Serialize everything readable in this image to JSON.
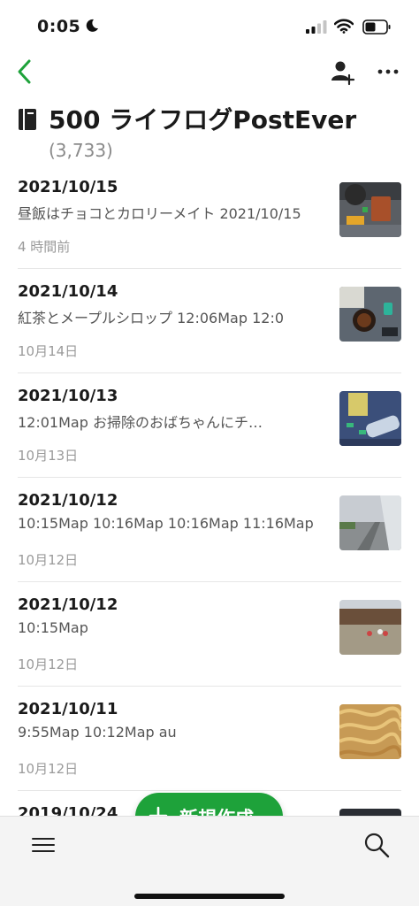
{
  "status_bar": {
    "time": "0:05"
  },
  "notebook": {
    "title": "500 ライフログPostEver",
    "count": "(3,733)"
  },
  "notes": [
    {
      "title": "2021/10/15",
      "snippet": "昼飯はチョコとカロリーメイト 2021/10/15",
      "date": "4 時間前",
      "thumb": "thumb-food-desk"
    },
    {
      "title": "2021/10/14",
      "snippet": "紅茶とメープルシロップ 12:06Map 12:0",
      "date": "10月14日",
      "thumb": "thumb-tea-desk"
    },
    {
      "title": "2021/10/13",
      "snippet": "12:01Map お掃除のおばちゃんにチ…",
      "date": "10月13日",
      "thumb": "thumb-bottle-desk"
    },
    {
      "title": "2021/10/12",
      "snippet": "10:15Map 10:16Map 10:16Map 11:16Map",
      "date": "10月12日",
      "thumb": "thumb-walkway"
    },
    {
      "title": "2021/10/12",
      "snippet": "10:15Map",
      "date": "10月12日",
      "thumb": "thumb-field"
    },
    {
      "title": "2021/10/11",
      "snippet": "9:55Map 10:12Map au",
      "date": "10月12日",
      "thumb": "thumb-noodles"
    },
    {
      "title": "2019/10/24",
      "snippet": "",
      "date": "",
      "thumb": "thumb-dark"
    }
  ],
  "new_note_button": {
    "label": "新規作成"
  },
  "colors": {
    "accent": "#1ea23a",
    "muted": "#9a9a9a"
  }
}
